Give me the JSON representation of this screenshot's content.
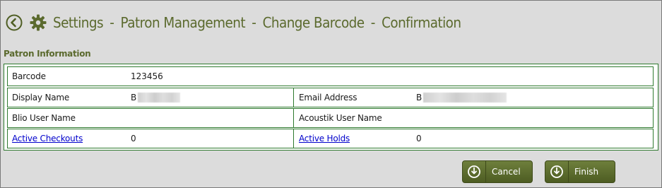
{
  "header": {
    "back_icon": "back-arrow-circle-icon",
    "settings_icon": "gear-icon",
    "breadcrumb": [
      "Settings",
      "Patron Management",
      "Change Barcode",
      "Confirmation"
    ],
    "separator": "-"
  },
  "section": {
    "title": "Patron Information"
  },
  "patron": {
    "barcode_label": "Barcode",
    "barcode_value": "123456",
    "display_name_label": "Display Name",
    "display_name_value": "B",
    "email_label": "Email Address",
    "email_value": "B",
    "blio_label": "Blio User Name",
    "blio_value": "",
    "acoustik_label": "Acoustik User Name",
    "acoustik_value": "",
    "checkouts_label": "Active Checkouts",
    "checkouts_value": "0",
    "holds_label": "Active Holds",
    "holds_value": "0"
  },
  "actions": {
    "cancel_label": "Cancel",
    "finish_label": "Finish",
    "button_icon": "power-download-icon"
  },
  "colors": {
    "accent": "#5b6a2e",
    "border": "#2f7a2f",
    "link": "#0000cc",
    "button": "#5a6a2c",
    "background": "#dcdcdc"
  }
}
